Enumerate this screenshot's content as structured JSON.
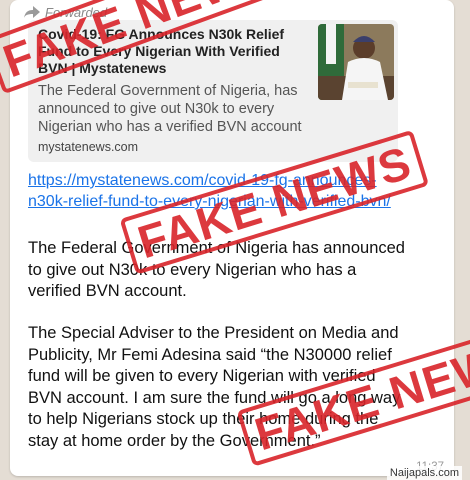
{
  "message": {
    "forwarded_label": "Forwarded",
    "preview": {
      "title": "Covid-19: FG Announces N30k Relief Fund to Every Nigerian With Verified BVN | Mystatenews",
      "description": "The Federal Government of Nigeria, has announced to give out N30k to every Nigerian who has a verified BVN account",
      "domain": "mystatenews.com"
    },
    "link": "https://mystatenews.com/covid-19-fg-announces-n30k-relief-fund-to-every-nigerian-with-verified-bvn/",
    "paragraph1": "The Federal Government of Nigeria has announced to give out N30k to every Nigerian who has a verified BVN account.",
    "paragraph2": "The Special Adviser to the President on Media and Publicity, Mr Femi Adesina said “the N30000 relief fund will be given to every Nigerian with verified BVN account. I am sure the fund will go a long way to help Nigerians stock up their home during the stay at home order by the Government.”",
    "time": "11:37"
  },
  "stamps": [
    "FAKE NEWS",
    "FAKE NEWS",
    "FAKE NEWS"
  ],
  "watermark": "Naijapals.com",
  "colors": {
    "stamp": "#d9242a",
    "link": "#1a73e8",
    "background": "#e4ddd4"
  }
}
